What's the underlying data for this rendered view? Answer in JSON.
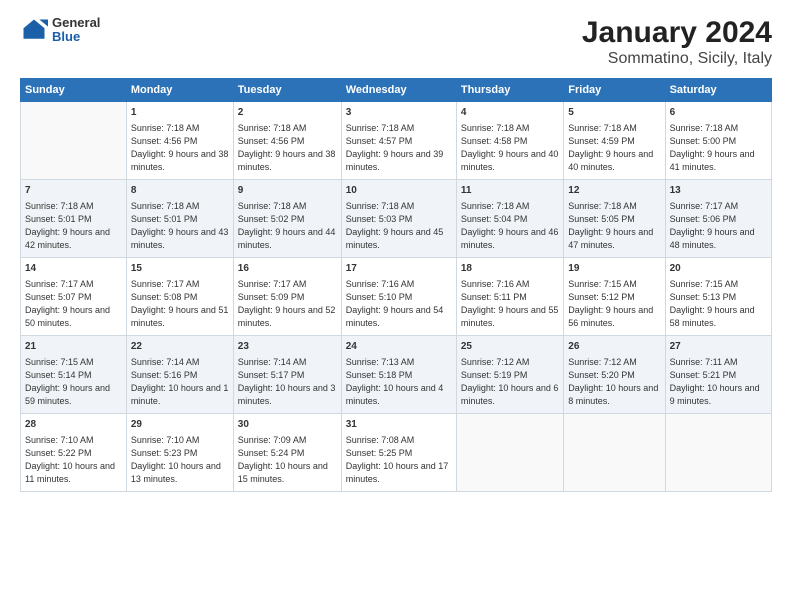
{
  "logo": {
    "general": "General",
    "blue": "Blue"
  },
  "title": "January 2024",
  "subtitle": "Sommatino, Sicily, Italy",
  "days_header": [
    "Sunday",
    "Monday",
    "Tuesday",
    "Wednesday",
    "Thursday",
    "Friday",
    "Saturday"
  ],
  "weeks": [
    [
      {
        "day": "",
        "sunrise": "",
        "sunset": "",
        "daylight": ""
      },
      {
        "day": "1",
        "sunrise": "Sunrise: 7:18 AM",
        "sunset": "Sunset: 4:56 PM",
        "daylight": "Daylight: 9 hours and 38 minutes."
      },
      {
        "day": "2",
        "sunrise": "Sunrise: 7:18 AM",
        "sunset": "Sunset: 4:56 PM",
        "daylight": "Daylight: 9 hours and 38 minutes."
      },
      {
        "day": "3",
        "sunrise": "Sunrise: 7:18 AM",
        "sunset": "Sunset: 4:57 PM",
        "daylight": "Daylight: 9 hours and 39 minutes."
      },
      {
        "day": "4",
        "sunrise": "Sunrise: 7:18 AM",
        "sunset": "Sunset: 4:58 PM",
        "daylight": "Daylight: 9 hours and 40 minutes."
      },
      {
        "day": "5",
        "sunrise": "Sunrise: 7:18 AM",
        "sunset": "Sunset: 4:59 PM",
        "daylight": "Daylight: 9 hours and 40 minutes."
      },
      {
        "day": "6",
        "sunrise": "Sunrise: 7:18 AM",
        "sunset": "Sunset: 5:00 PM",
        "daylight": "Daylight: 9 hours and 41 minutes."
      }
    ],
    [
      {
        "day": "7",
        "sunrise": "Sunrise: 7:18 AM",
        "sunset": "Sunset: 5:01 PM",
        "daylight": "Daylight: 9 hours and 42 minutes."
      },
      {
        "day": "8",
        "sunrise": "Sunrise: 7:18 AM",
        "sunset": "Sunset: 5:01 PM",
        "daylight": "Daylight: 9 hours and 43 minutes."
      },
      {
        "day": "9",
        "sunrise": "Sunrise: 7:18 AM",
        "sunset": "Sunset: 5:02 PM",
        "daylight": "Daylight: 9 hours and 44 minutes."
      },
      {
        "day": "10",
        "sunrise": "Sunrise: 7:18 AM",
        "sunset": "Sunset: 5:03 PM",
        "daylight": "Daylight: 9 hours and 45 minutes."
      },
      {
        "day": "11",
        "sunrise": "Sunrise: 7:18 AM",
        "sunset": "Sunset: 5:04 PM",
        "daylight": "Daylight: 9 hours and 46 minutes."
      },
      {
        "day": "12",
        "sunrise": "Sunrise: 7:18 AM",
        "sunset": "Sunset: 5:05 PM",
        "daylight": "Daylight: 9 hours and 47 minutes."
      },
      {
        "day": "13",
        "sunrise": "Sunrise: 7:17 AM",
        "sunset": "Sunset: 5:06 PM",
        "daylight": "Daylight: 9 hours and 48 minutes."
      }
    ],
    [
      {
        "day": "14",
        "sunrise": "Sunrise: 7:17 AM",
        "sunset": "Sunset: 5:07 PM",
        "daylight": "Daylight: 9 hours and 50 minutes."
      },
      {
        "day": "15",
        "sunrise": "Sunrise: 7:17 AM",
        "sunset": "Sunset: 5:08 PM",
        "daylight": "Daylight: 9 hours and 51 minutes."
      },
      {
        "day": "16",
        "sunrise": "Sunrise: 7:17 AM",
        "sunset": "Sunset: 5:09 PM",
        "daylight": "Daylight: 9 hours and 52 minutes."
      },
      {
        "day": "17",
        "sunrise": "Sunrise: 7:16 AM",
        "sunset": "Sunset: 5:10 PM",
        "daylight": "Daylight: 9 hours and 54 minutes."
      },
      {
        "day": "18",
        "sunrise": "Sunrise: 7:16 AM",
        "sunset": "Sunset: 5:11 PM",
        "daylight": "Daylight: 9 hours and 55 minutes."
      },
      {
        "day": "19",
        "sunrise": "Sunrise: 7:15 AM",
        "sunset": "Sunset: 5:12 PM",
        "daylight": "Daylight: 9 hours and 56 minutes."
      },
      {
        "day": "20",
        "sunrise": "Sunrise: 7:15 AM",
        "sunset": "Sunset: 5:13 PM",
        "daylight": "Daylight: 9 hours and 58 minutes."
      }
    ],
    [
      {
        "day": "21",
        "sunrise": "Sunrise: 7:15 AM",
        "sunset": "Sunset: 5:14 PM",
        "daylight": "Daylight: 9 hours and 59 minutes."
      },
      {
        "day": "22",
        "sunrise": "Sunrise: 7:14 AM",
        "sunset": "Sunset: 5:16 PM",
        "daylight": "Daylight: 10 hours and 1 minute."
      },
      {
        "day": "23",
        "sunrise": "Sunrise: 7:14 AM",
        "sunset": "Sunset: 5:17 PM",
        "daylight": "Daylight: 10 hours and 3 minutes."
      },
      {
        "day": "24",
        "sunrise": "Sunrise: 7:13 AM",
        "sunset": "Sunset: 5:18 PM",
        "daylight": "Daylight: 10 hours and 4 minutes."
      },
      {
        "day": "25",
        "sunrise": "Sunrise: 7:12 AM",
        "sunset": "Sunset: 5:19 PM",
        "daylight": "Daylight: 10 hours and 6 minutes."
      },
      {
        "day": "26",
        "sunrise": "Sunrise: 7:12 AM",
        "sunset": "Sunset: 5:20 PM",
        "daylight": "Daylight: 10 hours and 8 minutes."
      },
      {
        "day": "27",
        "sunrise": "Sunrise: 7:11 AM",
        "sunset": "Sunset: 5:21 PM",
        "daylight": "Daylight: 10 hours and 9 minutes."
      }
    ],
    [
      {
        "day": "28",
        "sunrise": "Sunrise: 7:10 AM",
        "sunset": "Sunset: 5:22 PM",
        "daylight": "Daylight: 10 hours and 11 minutes."
      },
      {
        "day": "29",
        "sunrise": "Sunrise: 7:10 AM",
        "sunset": "Sunset: 5:23 PM",
        "daylight": "Daylight: 10 hours and 13 minutes."
      },
      {
        "day": "30",
        "sunrise": "Sunrise: 7:09 AM",
        "sunset": "Sunset: 5:24 PM",
        "daylight": "Daylight: 10 hours and 15 minutes."
      },
      {
        "day": "31",
        "sunrise": "Sunrise: 7:08 AM",
        "sunset": "Sunset: 5:25 PM",
        "daylight": "Daylight: 10 hours and 17 minutes."
      },
      {
        "day": "",
        "sunrise": "",
        "sunset": "",
        "daylight": ""
      },
      {
        "day": "",
        "sunrise": "",
        "sunset": "",
        "daylight": ""
      },
      {
        "day": "",
        "sunrise": "",
        "sunset": "",
        "daylight": ""
      }
    ]
  ]
}
